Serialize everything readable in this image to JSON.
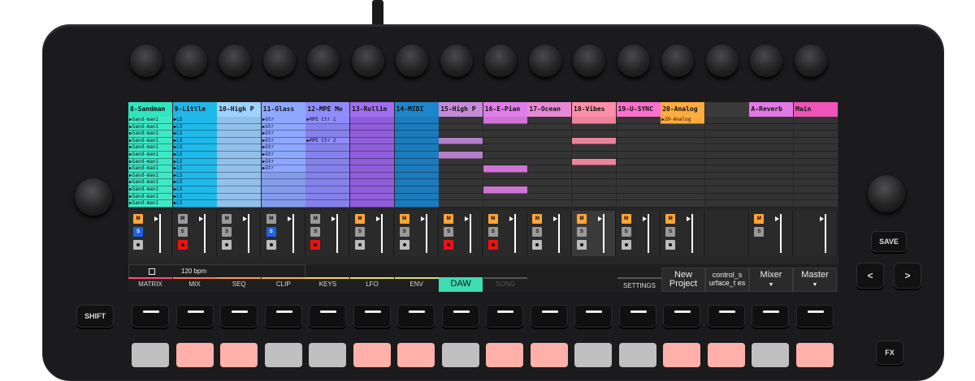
{
  "tracks": [
    {
      "name": "8-Sandman",
      "color": "#2ee6c0",
      "clip_color": "#3fe8c6",
      "clips": [
        "Sand-man1",
        "Sand-man1",
        "Sand-man1",
        "Sand-man1",
        "Sand-man1",
        "Sand-man1",
        "Sand-man1",
        "Sand-man1",
        "Sand-man1",
        "Sand-man1",
        "Sand-man1",
        "Sand-man1",
        "Sand-man1"
      ],
      "mute": "M",
      "solo": "S",
      "solo_on": true,
      "rec_on": false
    },
    {
      "name": "9-Little",
      "color": "#20b8e8",
      "clip_color": "#20b8e8",
      "clips": [
        "LS",
        "LS",
        "LS",
        "LS",
        "LS",
        "LS",
        "LS",
        "LS",
        "LS",
        "LS",
        "LS",
        "LS",
        "LS"
      ],
      "mute": "M",
      "solo": "S",
      "solo_on": false,
      "rec_on": true
    },
    {
      "name": "10-High P",
      "color": "#9ed2ff",
      "clip_color": "#9ed2ff",
      "clips": [
        "",
        "",
        "",
        "",
        "",
        "",
        "",
        "",
        "",
        "",
        "",
        "",
        ""
      ],
      "mute": "M",
      "solo": "S",
      "solo_on": false,
      "rec_on": false
    },
    {
      "name": "11-Glass",
      "color": "#8ea8ff",
      "clip_color": "#8ea8ff",
      "clips": [
        "Gtr",
        "Gtr",
        "Gtr",
        "Gtr",
        "Gtr",
        "Gtr",
        "Gtr",
        "Gtr",
        "",
        "",
        "",
        "",
        ""
      ],
      "mute": "M",
      "solo": "S",
      "solo_on": true,
      "rec_on": false
    },
    {
      "name": "12-MPE Mo",
      "color": "#8f8cff",
      "clip_color": "#8f8cff",
      "clips": [
        "MPE Ctr 1",
        "",
        "",
        "MPE Ctr 2",
        "",
        "",
        "",
        "",
        "",
        "",
        "",
        "",
        ""
      ],
      "mute": "M",
      "solo": "S",
      "solo_on": false,
      "rec_on": true
    },
    {
      "name": "13-Rollin",
      "color": "#a06ef0",
      "clip_color": "#9c66ee",
      "clips": [
        "",
        "",
        "",
        "",
        "",
        "",
        "",
        "",
        "",
        "",
        "",
        "",
        ""
      ],
      "mute": "M",
      "solo": "S",
      "solo_on": false,
      "rec_on": false
    },
    {
      "name": "14-MIDI",
      "color": "#1e86cc",
      "clip_color": "#1e86cc",
      "clips": [
        "",
        "",
        "",
        "",
        "",
        "",
        "",
        "",
        "",
        "",
        "",
        "",
        ""
      ],
      "mute": "M",
      "solo": "S",
      "solo_on": false,
      "rec_on": false
    },
    {
      "name": "15-High P",
      "color": "#c58ad8",
      "clip_color": "#c58ad8",
      "clips": [
        "",
        "",
        "",
        "",
        "",
        "",
        "",
        "",
        "",
        "",
        "",
        "",
        ""
      ],
      "mute": "M",
      "solo": "S",
      "solo_on": false,
      "rec_on": true
    },
    {
      "name": "16-E-Pian",
      "color": "#e07ee8",
      "clip_color": "#e07ee8",
      "clips": [
        "",
        "",
        "",
        "",
        "",
        "",
        "",
        "",
        "",
        "",
        "",
        "",
        ""
      ],
      "mute": "M",
      "solo": "S",
      "solo_on": false,
      "rec_on": true
    },
    {
      "name": "17-Ocean",
      "color": "#e889d6",
      "clip_color": "#e889d6",
      "clips": [
        "",
        "",
        "",
        "",
        "",
        "",
        "",
        "",
        "",
        "",
        "",
        "",
        ""
      ],
      "mute": "M",
      "solo": "S",
      "solo_on": false,
      "rec_on": false
    },
    {
      "name": "18-Vibes",
      "color": "#ff8fa8",
      "clip_color": "#ff8fa8",
      "clips": [
        "",
        "",
        "",
        "",
        "",
        "",
        "",
        "",
        "",
        "",
        "",
        "",
        ""
      ],
      "mute": "M",
      "solo": "S",
      "solo_on": false,
      "rec_on": false
    },
    {
      "name": "19-U-SYNC",
      "color": "#ff6fce",
      "clip_color": "#ff6fce",
      "clips": [
        "",
        "",
        "",
        "",
        "",
        "",
        "",
        "",
        "",
        "",
        "",
        "",
        ""
      ],
      "mute": "M",
      "solo": "S",
      "solo_on": false,
      "rec_on": false
    },
    {
      "name": "20-Analog",
      "color": "#ffab3d",
      "clip_color": "#ffab3d",
      "clips": [
        "20-Analog",
        "",
        "",
        "",
        "",
        "",
        "",
        "",
        "",
        "",
        "",
        "",
        ""
      ],
      "mute": "M",
      "solo": "S",
      "solo_on": false,
      "rec_on": false
    },
    {
      "name": "",
      "color": "#3a3a3a",
      "clip_color": "#3a3a3a",
      "clips": [],
      "mute": "",
      "solo": "",
      "solo_on": false,
      "rec_on": false
    },
    {
      "name": "A-Reverb",
      "color": "#e27ae6",
      "clip_color": "#e27ae6",
      "clips": [],
      "mute": "M",
      "solo": "S",
      "solo_on": false,
      "rec_on": false
    },
    {
      "name": "Main",
      "color": "#ee55b8",
      "clip_color": "#ee55b8",
      "clips": [],
      "mute": "",
      "solo": "",
      "solo_on": false,
      "rec_on": false
    }
  ],
  "transport": {
    "bpm": "120 bpm"
  },
  "tabs": [
    {
      "label": "MATRIX",
      "color": "#ff4c7a"
    },
    {
      "label": "MIX",
      "color": "#ff7a4c"
    },
    {
      "label": "SEQ",
      "color": "#ff9d3b"
    },
    {
      "label": "CLIP",
      "color": "#ffb83b"
    },
    {
      "label": "KEYS",
      "color": "#ffd23b"
    },
    {
      "label": "LFO",
      "color": "#f0e04c"
    },
    {
      "label": "ENV",
      "color": "#d8e070"
    },
    {
      "label": "DAW",
      "color": "#3ddcb2"
    },
    {
      "label": "SONG",
      "color": "#555"
    }
  ],
  "right_buttons": {
    "settings": "SETTINGS",
    "new_project": "New Project",
    "control_surface": "control_s urface_t es",
    "mixer": "Mixer",
    "master": "Master"
  },
  "hardware": {
    "save": "SAVE",
    "shift": "SHIFT",
    "prev": "<",
    "next": ">",
    "fx": "FX"
  },
  "pad_colors": [
    "#c0c0c0",
    "#ffb0a8",
    "#ffb0a8",
    "#c0c0c0",
    "#c0c0c0",
    "#ffb0a8",
    "#ffb0a8",
    "#c0c0c0",
    "#ffb0a8",
    "#ffb0a8",
    "#c0c0c0",
    "#c0c0c0",
    "#ffb0a8",
    "#ffb0a8",
    "#c0c0c0",
    "#ffb0a8"
  ]
}
